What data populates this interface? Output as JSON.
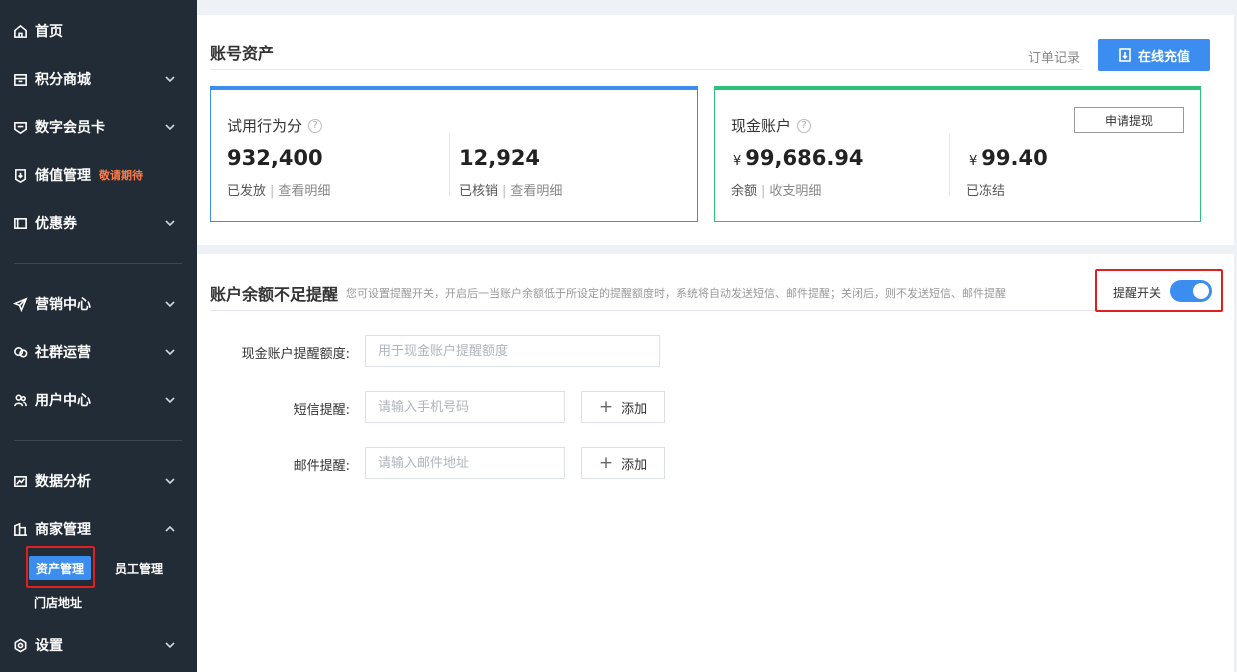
{
  "sidebar": {
    "items": [
      {
        "label": "首页",
        "icon": "home-icon"
      },
      {
        "label": "积分商城",
        "icon": "store-icon"
      },
      {
        "label": "数字会员卡",
        "icon": "card-icon"
      },
      {
        "label": "储值管理",
        "icon": "wallet-icon",
        "badge": "敬请期待"
      },
      {
        "label": "优惠券",
        "icon": "coupon-icon"
      },
      {
        "label": "营销中心",
        "icon": "send-icon"
      },
      {
        "label": "社群运营",
        "icon": "chat-icon"
      },
      {
        "label": "用户中心",
        "icon": "users-icon"
      },
      {
        "label": "数据分析",
        "icon": "chart-icon"
      },
      {
        "label": "商家管理",
        "icon": "building-icon"
      },
      {
        "label": "设置",
        "icon": "settings-icon"
      }
    ],
    "sub": {
      "asset": "资产管理",
      "staff": "员工管理",
      "store": "门店地址"
    }
  },
  "assets": {
    "title": "账号资产",
    "order_link": "订单记录",
    "recharge": "在线充值",
    "trial": {
      "title": "试用行为分",
      "issued_value": "932,400",
      "issued_label": "已发放",
      "issued_link": "查看明细",
      "verified_value": "12,924",
      "verified_label": "已核销",
      "verified_link": "查看明细"
    },
    "cash": {
      "title": "现金账户",
      "withdraw": "申请提现",
      "currency": "¥",
      "balance_value": "99,686.94",
      "balance_label": "余额",
      "balance_link": "收支明细",
      "frozen_value": "99.40",
      "frozen_label": "已冻结"
    },
    "colors": {
      "trial_accent": "#3b8ef0",
      "cash_accent": "#2fc07e"
    }
  },
  "reminder": {
    "title": "账户余额不足提醒",
    "desc": "您可设置提醒开关，开启后一当账户余额低于所设定的提醒额度时，系统将自动发送短信、邮件提醒；关闭后，则不发送短信、邮件提醒",
    "toggle_label": "提醒开关",
    "toggle_on": true,
    "fields": {
      "threshold_label": "现金账户提醒额度:",
      "threshold_placeholder": "用于现金账户提醒额度",
      "sms_label": "短信提醒:",
      "sms_placeholder": "请输入手机号码",
      "email_label": "邮件提醒:",
      "email_placeholder": "请输入邮件地址",
      "add": "添加"
    }
  }
}
